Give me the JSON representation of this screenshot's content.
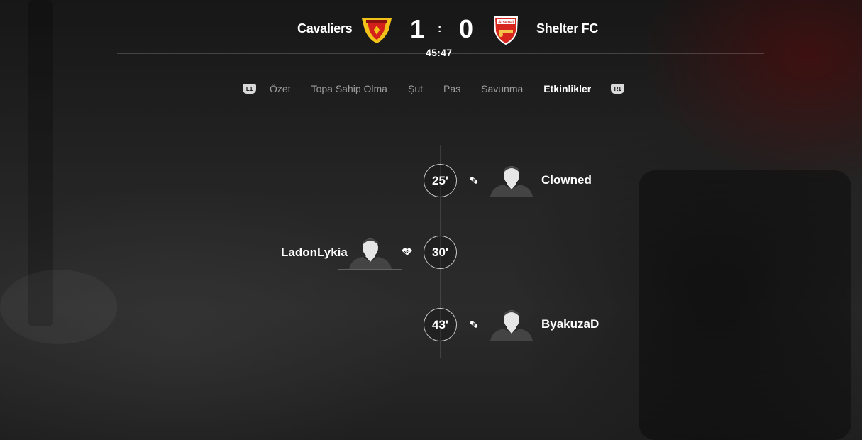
{
  "match": {
    "home": {
      "name": "Cavaliers",
      "score": "1",
      "crest_colors": [
        "#f2c21a",
        "#d3201b"
      ]
    },
    "away": {
      "name": "Shelter FC",
      "score": "0",
      "crest_colors": [
        "#d7261d",
        "#ffffff"
      ],
      "crest_text": "Arsenal"
    },
    "separator": ":",
    "clock": "45:47"
  },
  "tabs": {
    "left_bumper": "L1",
    "right_bumper": "R1",
    "items": [
      {
        "label": "Özet"
      },
      {
        "label": "Topa Sahip Olma"
      },
      {
        "label": "Şut"
      },
      {
        "label": "Pas"
      },
      {
        "label": "Savunma"
      },
      {
        "label": "Etkinlikler",
        "active": true
      }
    ]
  },
  "events": [
    {
      "minute": "25'",
      "side": "away",
      "player": "Clowned",
      "icon": "bandage-icon"
    },
    {
      "minute": "30'",
      "side": "home",
      "player": "LadonLykia",
      "icon": "handshake-icon"
    },
    {
      "minute": "43'",
      "side": "away",
      "player": "ByakuzaD",
      "icon": "bandage-icon"
    }
  ]
}
